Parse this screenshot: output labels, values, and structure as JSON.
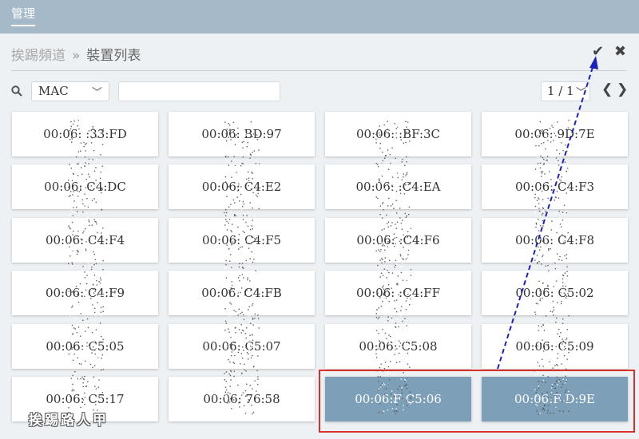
{
  "header": {
    "tab_label": "管理"
  },
  "breadcrumb": {
    "parent": "挨踢頻道",
    "separator": "»",
    "current": "裝置列表"
  },
  "toolbar": {
    "confirm_icon": "checkmark-icon",
    "close_icon": "close-icon"
  },
  "filter": {
    "field_value": "MAC",
    "search_placeholder": "",
    "search_value": ""
  },
  "pagination": {
    "value": "1 / 1",
    "prev_icon": "chevron-left-icon",
    "next_icon": "chevron-right-icon"
  },
  "devices": [
    {
      "label": "00:06:  :33:FD",
      "selected": false
    },
    {
      "label": "00:06:    BD:97",
      "selected": false
    },
    {
      "label": "00:06:    :BF:3C",
      "selected": false
    },
    {
      "label": "00:06:    9D:7E",
      "selected": false
    },
    {
      "label": "00:06:    C4:DC",
      "selected": false
    },
    {
      "label": "00:06:    C4:E2",
      "selected": false
    },
    {
      "label": "00:06:    :C4:EA",
      "selected": false
    },
    {
      "label": "00:06:    C4:F3",
      "selected": false
    },
    {
      "label": "00:06:    C4:F4",
      "selected": false
    },
    {
      "label": "00:06:    C4:F5",
      "selected": false
    },
    {
      "label": "00:06:    :C4:F6",
      "selected": false
    },
    {
      "label": "00:06:    C4:F8",
      "selected": false
    },
    {
      "label": "00:06:    C4:F9",
      "selected": false
    },
    {
      "label": "00:06:    C4:FB",
      "selected": false
    },
    {
      "label": "00:06:    :C4:FF",
      "selected": false
    },
    {
      "label": "00:06:    C5:02",
      "selected": false
    },
    {
      "label": "00:06:    C5:05",
      "selected": false
    },
    {
      "label": "00:06:    C5:07",
      "selected": false
    },
    {
      "label": "00:06:    C5:08",
      "selected": false
    },
    {
      "label": "00:06:    C5:09",
      "selected": false
    },
    {
      "label": "00:06:    C5:17",
      "selected": false
    },
    {
      "label": "00:06:    76:58",
      "selected": false
    },
    {
      "label": "00:06:F    C5:06",
      "selected": true
    },
    {
      "label": "00:06:F    D:9E",
      "selected": true
    }
  ],
  "annotation": {
    "watermark": "挨踢路人甲",
    "highlight_color": "#d9302c",
    "arrow_color": "#1a22b8"
  },
  "colors": {
    "topbar": "#a5b9c8",
    "selected_card": "#7e9fb8",
    "background": "#eef1f4"
  }
}
